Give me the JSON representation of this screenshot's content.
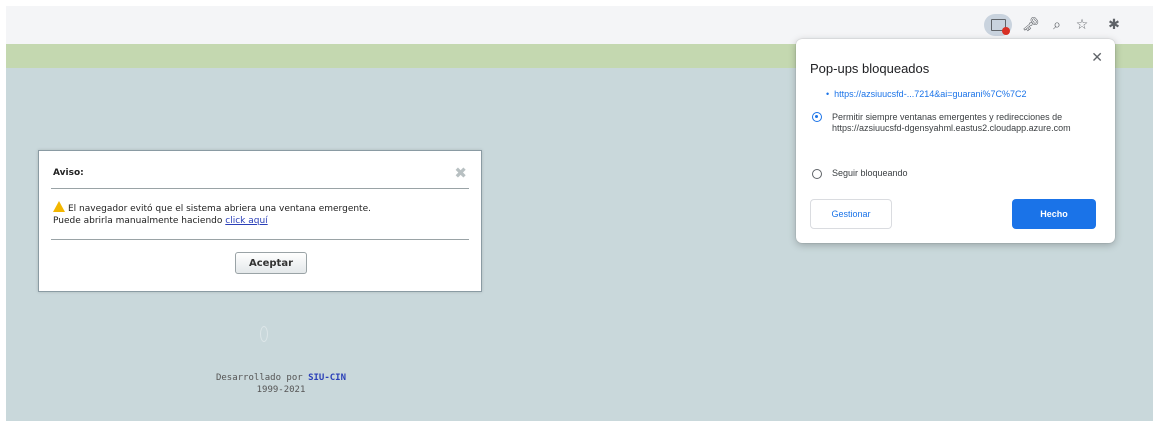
{
  "toolbar": {
    "icons": {
      "popup_blocked": "popup-blocked-icon",
      "key": "key-icon",
      "zoom": "zoom-icon",
      "star": "star-icon",
      "extensions": "puzzle-icon"
    },
    "key_glyph": "🗝",
    "zoom_glyph": "⌕",
    "star_glyph": "☆",
    "ext_glyph": "✱"
  },
  "aviso": {
    "title": "Aviso:",
    "close_glyph": "✖",
    "message_line1": "El navegador evitó que el sistema abriera una ventana emergente.",
    "message_line2": "Puede abrirla manualmente haciendo",
    "link_text": "click aquí",
    "accept_label": "Aceptar"
  },
  "footer": {
    "developed_by": "Desarrollado por",
    "org": "SIU-CIN",
    "years": "1999-2021"
  },
  "popup_bubble": {
    "title": "Pop-ups bloqueados",
    "close_glyph": "✕",
    "blocked_url": "https://azsiuucsfd-...7214&ai=guarani%7C%7C2",
    "allow_option": "Permitir siempre ventanas emergentes y redirecciones de https://azsiuucsfd-dgensyahml.eastus2.cloudapp.azure.com",
    "allow_selected": true,
    "keep_option": "Seguir bloqueando",
    "manage_label": "Gestionar",
    "done_label": "Hecho"
  },
  "colors": {
    "page_background": "#c9d8db",
    "header_band": "#c4d8b0",
    "accent_blue": "#1a73e8",
    "link_blue": "#2a3fb8",
    "warning_yellow": "#f2b600"
  }
}
